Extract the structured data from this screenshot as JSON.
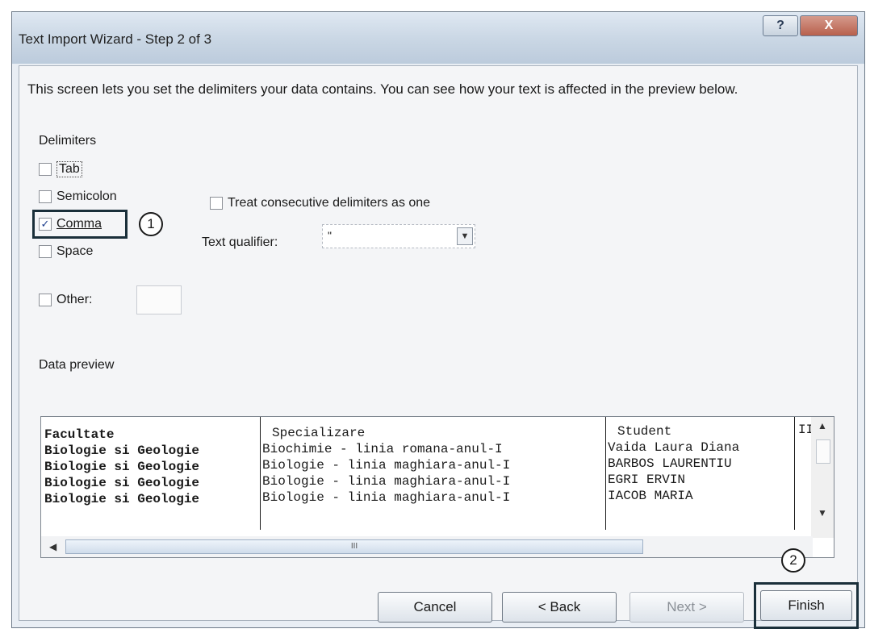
{
  "window": {
    "title": "Text Import Wizard - Step 2 of 3",
    "help_label": "?",
    "close_label": "X"
  },
  "description": "This screen lets you set the delimiters your data contains.  You can see how your text is affected in the preview below.",
  "delimiters": {
    "heading": "Delimiters",
    "options": [
      {
        "label": "Tab",
        "checked": false
      },
      {
        "label": "Semicolon",
        "checked": false
      },
      {
        "label": "Comma",
        "checked": true
      },
      {
        "label": "Space",
        "checked": false
      },
      {
        "label": "Other:",
        "checked": false
      }
    ],
    "other_value": ""
  },
  "consecutive": {
    "label": "Treat consecutive delimiters as one",
    "checked": false
  },
  "qualifier": {
    "label": "Text qualifier:",
    "value": "\""
  },
  "annotations": {
    "one": "1",
    "two": "2"
  },
  "preview": {
    "heading": "Data preview",
    "columns": [
      {
        "header": "Facultate",
        "cells": [
          "Biologie si Geologie",
          "Biologie si Geologie",
          "Biologie si Geologie",
          "Biologie si Geologie"
        ]
      },
      {
        "header": "Specializare",
        "cells": [
          "Biochimie - linia romana-anul-I",
          "Biologie - linia maghiara-anul-I",
          "Biologie - linia maghiara-anul-I",
          "Biologie - linia maghiara-anul-I"
        ]
      },
      {
        "header": "Student",
        "cells": [
          "Vaida Laura Diana",
          "BARBOS LAURENTIU",
          "EGRI ERVIN",
          "IACOB MARIA"
        ]
      },
      {
        "header": "II",
        "cells": [
          "",
          "",
          "",
          ""
        ]
      }
    ],
    "scroll_thumb": "III"
  },
  "buttons": {
    "cancel": "Cancel",
    "back": "< Back",
    "next": "Next >",
    "finish": "Finish"
  }
}
